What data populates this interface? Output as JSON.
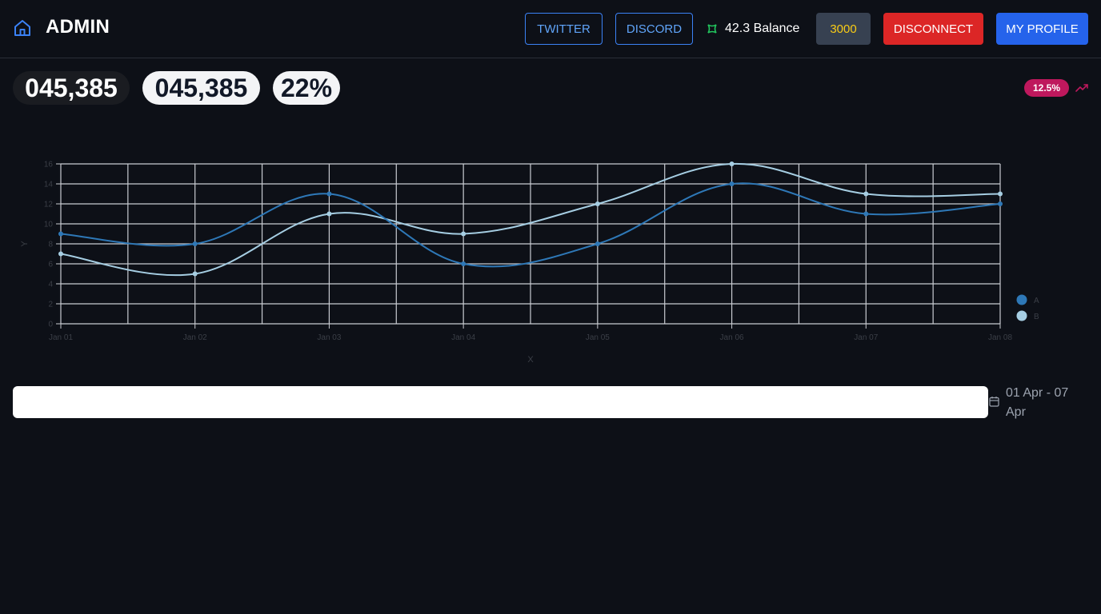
{
  "header": {
    "brand": "ADMIN",
    "twitter_label": "TWITTER",
    "discord_label": "DISCORD",
    "balance_text": "42.3 Balance",
    "credits_label": "3000",
    "disconnect_label": "DISCONNECT",
    "profile_label": "MY PROFILE",
    "icons": {
      "home": "home-icon",
      "balance": "token-icon"
    }
  },
  "stats": [
    {
      "value": "045,385"
    },
    {
      "value": "045,385"
    },
    {
      "value": "22%"
    }
  ],
  "trend": {
    "badge": "12.5%",
    "icon": "trending-up-icon",
    "color": "#be185d"
  },
  "chart_data": {
    "type": "line",
    "xlabel": "X",
    "ylabel": "Y",
    "x": [
      "Jan 01",
      "Jan 02",
      "Jan 03",
      "Jan 04",
      "Jan 05",
      "Jan 06",
      "Jan 07",
      "Jan 08"
    ],
    "ylim": [
      0,
      16
    ],
    "yticks": [
      0,
      2,
      4,
      6,
      8,
      10,
      12,
      14,
      16
    ],
    "grid": true,
    "legend": "right",
    "series": [
      {
        "name": "A",
        "color": "#2e78b7",
        "values": [
          9,
          8,
          13,
          6,
          8,
          14,
          11,
          12
        ]
      },
      {
        "name": "B",
        "color": "#a6cee3",
        "values": [
          7,
          5,
          11,
          9,
          12,
          16,
          13,
          13
        ]
      }
    ]
  },
  "date_range": {
    "text": "01 Apr - 07 Apr",
    "icon": "calendar-icon"
  },
  "colors": {
    "background": "#0d1017",
    "accent": "#2563eb",
    "danger": "#dc2626"
  }
}
